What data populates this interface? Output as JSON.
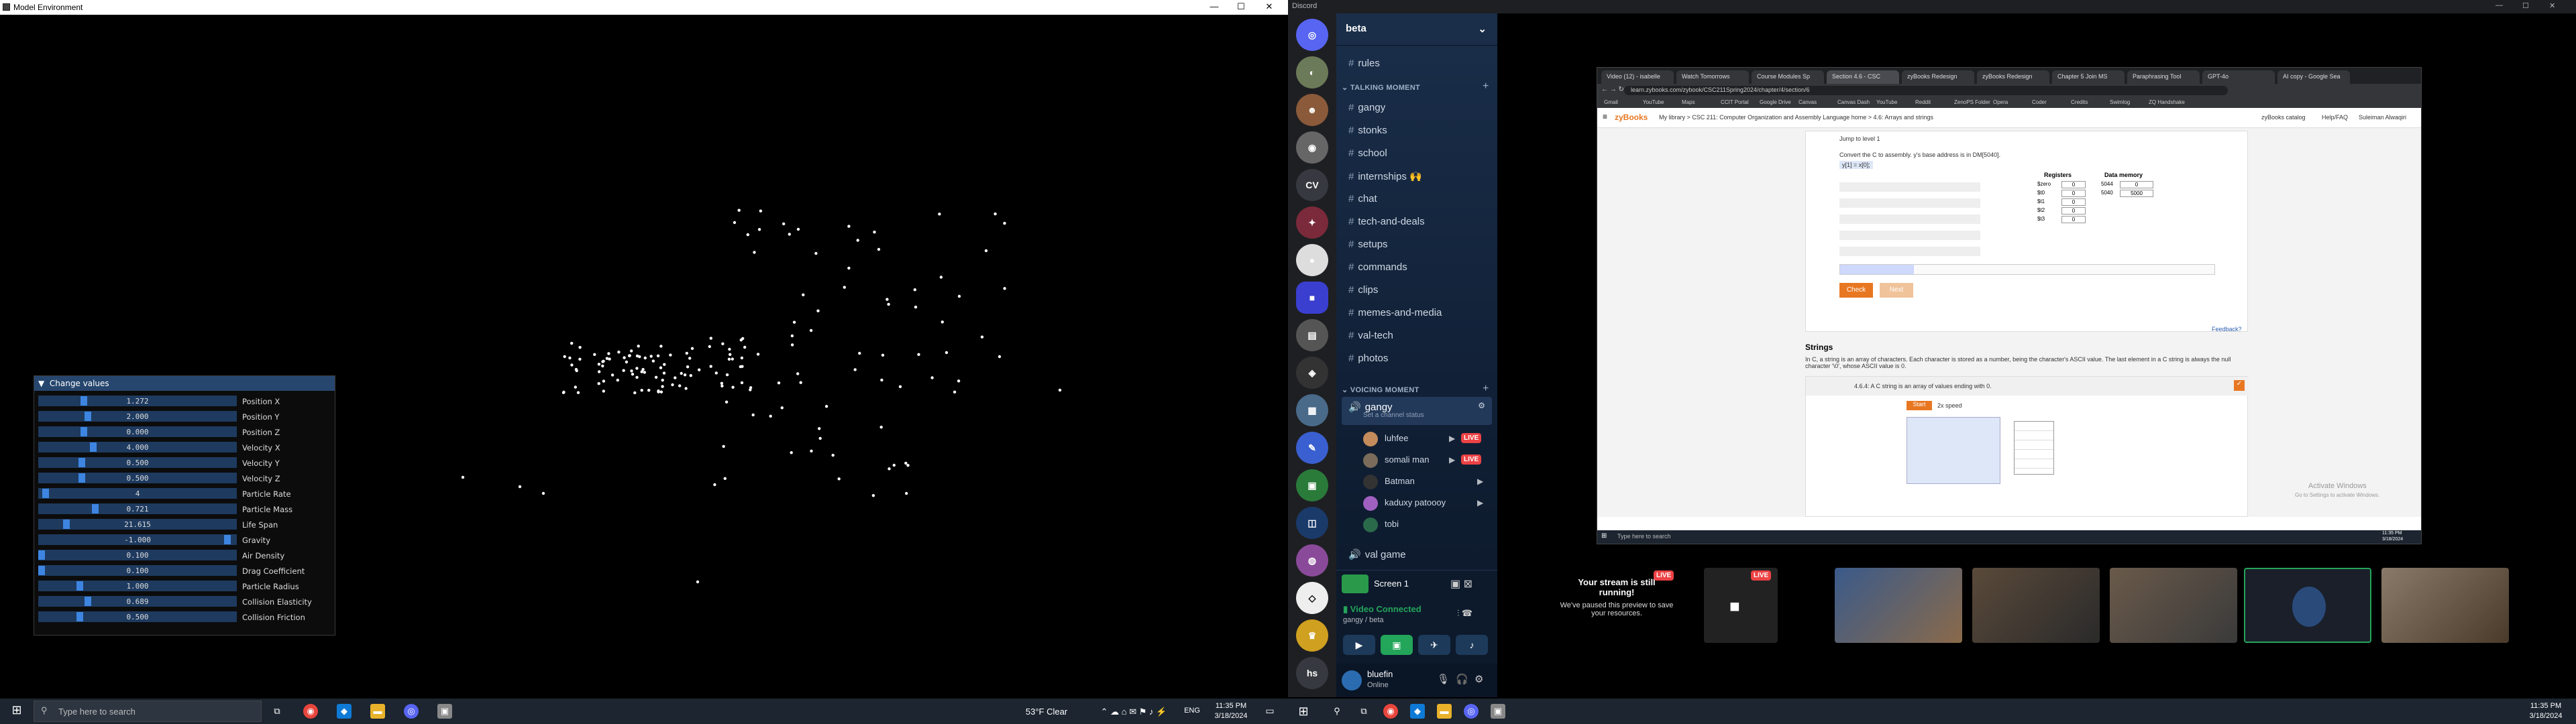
{
  "left_monitor": {
    "window_title": "Model Environment",
    "window_controls": [
      "—",
      "☐",
      "✕"
    ],
    "panel": {
      "title": "Change values",
      "rows": [
        {
          "label": "Position X",
          "value": "1.272",
          "fraction": 0.22
        },
        {
          "label": "Position Y",
          "value": "2.000",
          "fraction": 0.24
        },
        {
          "label": "Position Z",
          "value": "0.000",
          "fraction": 0.22
        },
        {
          "label": "Velocity X",
          "value": "4.000",
          "fraction": 0.27
        },
        {
          "label": "Velocity Y",
          "value": "0.500",
          "fraction": 0.21
        },
        {
          "label": "Velocity Z",
          "value": "0.500",
          "fraction": 0.21
        },
        {
          "label": "Particle Rate",
          "value": "4",
          "fraction": 0.02
        },
        {
          "label": "Particle Mass",
          "value": "0.721",
          "fraction": 0.28
        },
        {
          "label": "Life Span",
          "value": "21.615",
          "fraction": 0.13
        },
        {
          "label": "Gravity",
          "value": "-1.000",
          "fraction": 0.97
        },
        {
          "label": "Air Density",
          "value": "0.100",
          "fraction": 0.0
        },
        {
          "label": "Drag Coefficient",
          "value": "0.100",
          "fraction": 0.0
        },
        {
          "label": "Particle Radius",
          "value": "1.000",
          "fraction": 0.2
        },
        {
          "label": "Collision Elasticity",
          "value": "0.689",
          "fraction": 0.24
        },
        {
          "label": "Collision Friction",
          "value": "0.500",
          "fraction": 0.2
        }
      ]
    },
    "taskbar": {
      "search_placeholder": "Type here to search",
      "weather": "53°F  Clear",
      "lang": "ENG",
      "time": "11:35 PM",
      "date": "3/18/2024"
    }
  },
  "right_monitor": {
    "app_name": "Discord",
    "discord": {
      "server_name": "beta",
      "channels_top": [
        "rules"
      ],
      "category_text": "TALKING MOMENT",
      "text_channels": [
        "gangy",
        "stonks",
        "school",
        "internships 🙌",
        "chat",
        "tech-and-deals",
        "setups",
        "commands",
        "clips",
        "memes-and-media",
        "val-tech",
        "photos"
      ],
      "category_voice": "VOICING MOMENT",
      "voice_channel": "gangy",
      "voice_status": "Set a channel status",
      "voice_users": [
        {
          "name": "luhfee",
          "live": "LIVE",
          "color": "#c48b5c"
        },
        {
          "name": "somali man",
          "live": "LIVE",
          "color": "#7a6b5a"
        },
        {
          "name": "Batman",
          "live": "",
          "color": "#333333"
        },
        {
          "name": "kaduxy patoooy",
          "live": "",
          "color": "#a060c0"
        },
        {
          "name": "tobi",
          "live": "",
          "color": "#2a6a4a"
        }
      ],
      "val_game": "val game",
      "screen_share": "Screen 1",
      "video_connected": "Video Connected",
      "video_channel": "gangy / beta",
      "user_name": "bluefin",
      "user_status": "Online",
      "server_letters": [
        "CV",
        "hs"
      ]
    },
    "browser": {
      "tabs": [
        "Video (12) - isabelle",
        "Watch Tomorrows",
        "Course Modules Sp",
        "Section 4.6 - CSC",
        "zyBooks Redesign",
        "zyBooks Redesign",
        "Chapter 5 Join MS",
        "Paraphrasing Tool",
        "GPT-4o",
        "AI copy - Google Sea"
      ],
      "url": "learn.zybooks.com/zybook/CSC211Spring2024/chapter/4/section/6",
      "bookmarks": [
        "Gmail",
        "YouTube",
        "Maps",
        "CCIT Portal",
        "Google Drive",
        "Canvas",
        "Canvas Dash",
        "YouTube",
        "Reddit",
        "ZenoPS Folder",
        "Opera",
        "Coder",
        "Credits",
        "Swimlog",
        "ZQ Handshake"
      ],
      "breadcrumb": "My library > CSC 211: Computer Organization and Assembly Language home > 4.6: Arrays and strings",
      "zy_logo": "zyBooks",
      "zy_catalog": "zyBooks catalog",
      "zy_help": "Help/FAQ",
      "zy_user": "Suleiman Alwaqiri",
      "jump_text": "Jump to level 1",
      "prompt": "Convert the C to assembly. y's base address is in DM[5040].",
      "code_y": "y[1] = x[0];",
      "registers_label": "Registers",
      "data_memory_label": "Data memory",
      "reg_names": [
        "$zero",
        "$t0",
        "$t1",
        "$t2",
        "$t3"
      ],
      "reg_values": [
        "0",
        "0",
        "0",
        "0",
        "0"
      ],
      "mem_addrs": [
        "5044",
        "5040"
      ],
      "mem_values": [
        "0",
        "5000"
      ],
      "check_btn": "Check",
      "next_btn": "Next",
      "feedback": "Feedback?",
      "strings_heading": "Strings",
      "strings_text": "In C, a string is an array of characters. Each character is stored as a number, being the character's ASCII value. The last element in a C string is always the null character '\\0', whose ASCII value is 0.",
      "participation": "4.6.4: A C string is an array of values ending with 0.",
      "start_btn": "Start",
      "speed": "2x speed",
      "activate1": "Activate Windows",
      "activate2": "Go to Settings to activate Windows.",
      "taskbar_search": "Type here to search",
      "taskbar_time": "11:35 PM",
      "taskbar_date": "3/18/2024"
    },
    "stream_paused": {
      "title": "Your stream is still running!",
      "subtitle": "We've paused this preview to save your resources.",
      "live": "LIVE"
    },
    "taskbar": {
      "time": "11:35 PM",
      "date": "3/18/2024"
    }
  },
  "colors": {
    "slider_bg": "#1e3a5f",
    "slider_grab": "#3d85e0",
    "discord_accent": "#5865f2",
    "live_red": "#ed4245",
    "zy_orange": "#e87722"
  }
}
